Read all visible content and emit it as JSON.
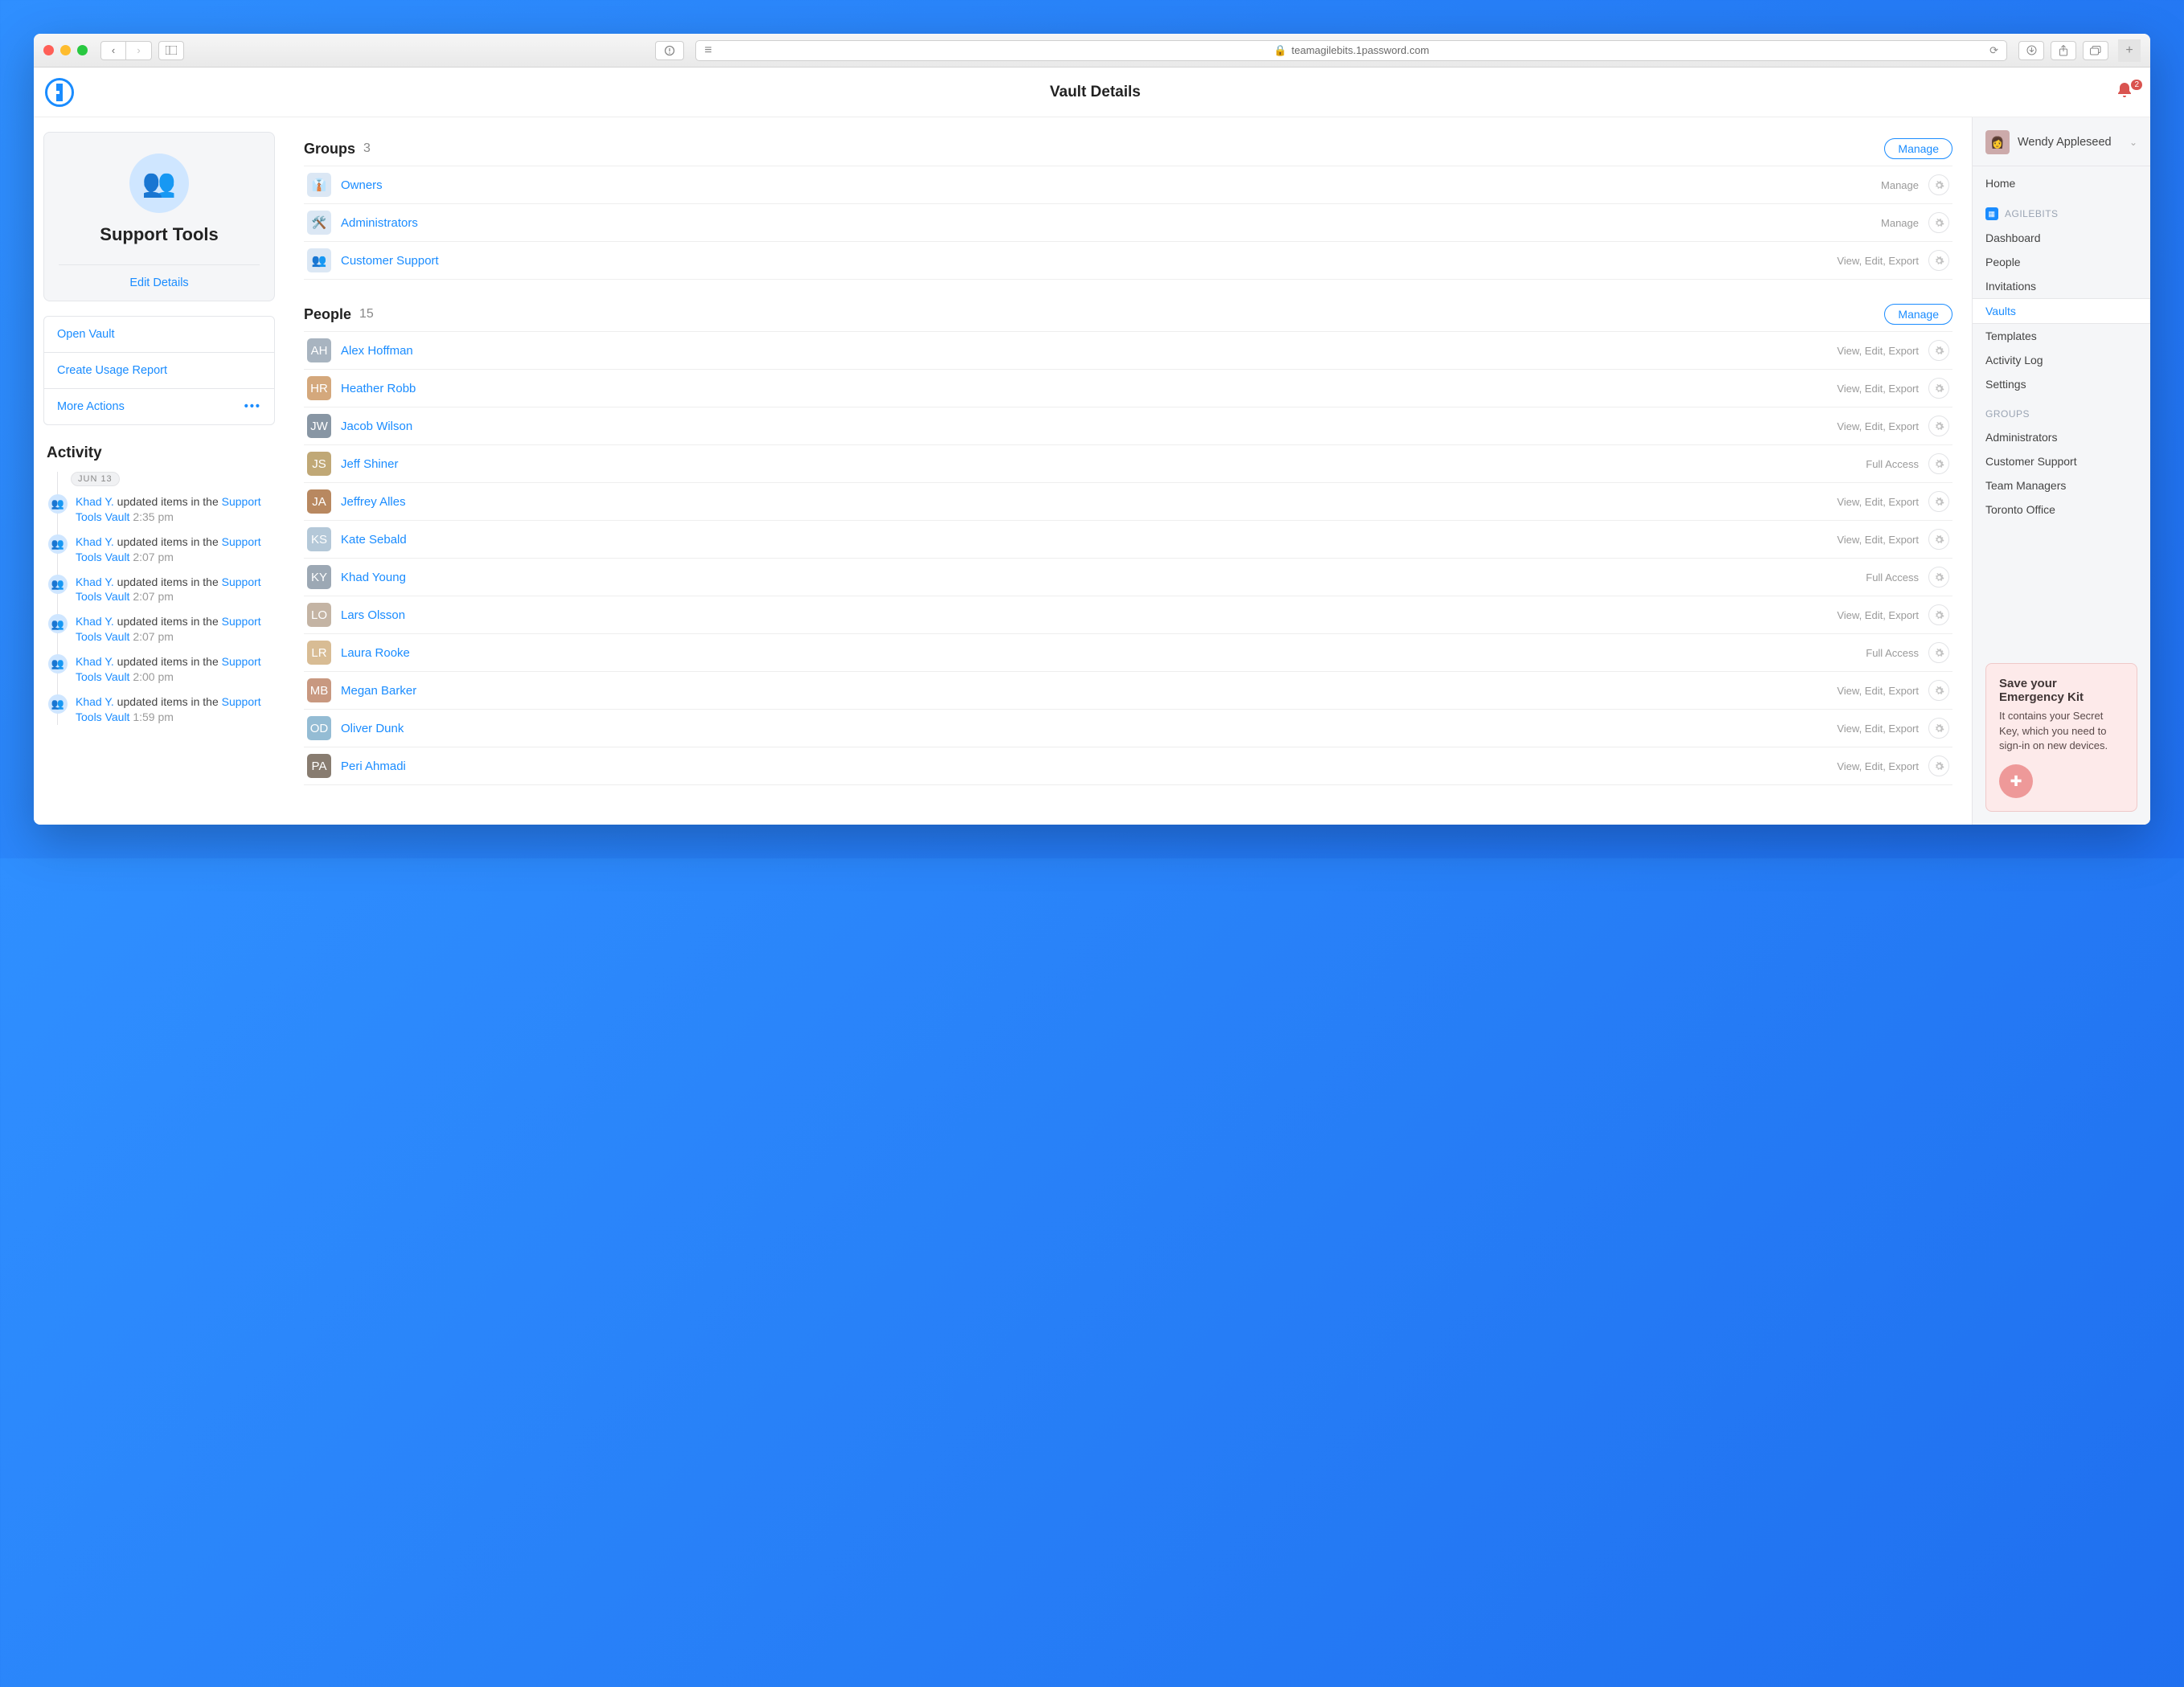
{
  "browser": {
    "url": "teamagilebits.1password.com"
  },
  "header": {
    "title": "Vault Details",
    "notification_count": "2"
  },
  "vault": {
    "name": "Support Tools",
    "edit_label": "Edit Details"
  },
  "actions": {
    "open": "Open Vault",
    "report": "Create Usage Report",
    "more": "More Actions"
  },
  "activity": {
    "heading": "Activity",
    "date": "JUN 13",
    "items": [
      {
        "actor": "Khad Y.",
        "verb": "updated items in the",
        "target": "Support Tools Vault",
        "time": "2:35 pm"
      },
      {
        "actor": "Khad Y.",
        "verb": "updated items in the",
        "target": "Support Tools Vault",
        "time": "2:07 pm"
      },
      {
        "actor": "Khad Y.",
        "verb": "updated items in the",
        "target": "Support Tools Vault",
        "time": "2:07 pm"
      },
      {
        "actor": "Khad Y.",
        "verb": "updated items in the",
        "target": "Support Tools Vault",
        "time": "2:07 pm"
      },
      {
        "actor": "Khad Y.",
        "verb": "updated items in the",
        "target": "Support Tools Vault",
        "time": "2:00 pm"
      },
      {
        "actor": "Khad Y.",
        "verb": "updated items in the",
        "target": "Support Tools Vault",
        "time": "1:59 pm"
      }
    ]
  },
  "groups": {
    "heading": "Groups",
    "count": "3",
    "manage_label": "Manage",
    "items": [
      {
        "name": "Owners",
        "perms": "Manage"
      },
      {
        "name": "Administrators",
        "perms": "Manage"
      },
      {
        "name": "Customer Support",
        "perms": "View, Edit, Export"
      }
    ]
  },
  "people": {
    "heading": "People",
    "count": "15",
    "manage_label": "Manage",
    "items": [
      {
        "name": "Alex Hoffman",
        "perms": "View, Edit, Export"
      },
      {
        "name": "Heather Robb",
        "perms": "View, Edit, Export"
      },
      {
        "name": "Jacob Wilson",
        "perms": "View, Edit, Export"
      },
      {
        "name": "Jeff Shiner",
        "perms": "Full Access"
      },
      {
        "name": "Jeffrey Alles",
        "perms": "View, Edit, Export"
      },
      {
        "name": "Kate Sebald",
        "perms": "View, Edit, Export"
      },
      {
        "name": "Khad Young",
        "perms": "Full Access"
      },
      {
        "name": "Lars Olsson",
        "perms": "View, Edit, Export"
      },
      {
        "name": "Laura Rooke",
        "perms": "Full Access"
      },
      {
        "name": "Megan Barker",
        "perms": "View, Edit, Export"
      },
      {
        "name": "Oliver Dunk",
        "perms": "View, Edit, Export"
      },
      {
        "name": "Peri Ahmadi",
        "perms": "View, Edit, Export"
      }
    ]
  },
  "user": {
    "name": "Wendy Appleseed"
  },
  "nav": {
    "home": "Home",
    "org": "AGILEBITS",
    "dashboard": "Dashboard",
    "people": "People",
    "invitations": "Invitations",
    "vaults": "Vaults",
    "templates": "Templates",
    "activity": "Activity Log",
    "settings": "Settings",
    "groups_heading": "GROUPS",
    "groups": [
      "Administrators",
      "Customer Support",
      "Team Managers",
      "Toronto Office"
    ]
  },
  "emergency": {
    "title": "Save your Emergency Kit",
    "body": "It contains your Secret Key, which you need to sign-in on new devices."
  }
}
